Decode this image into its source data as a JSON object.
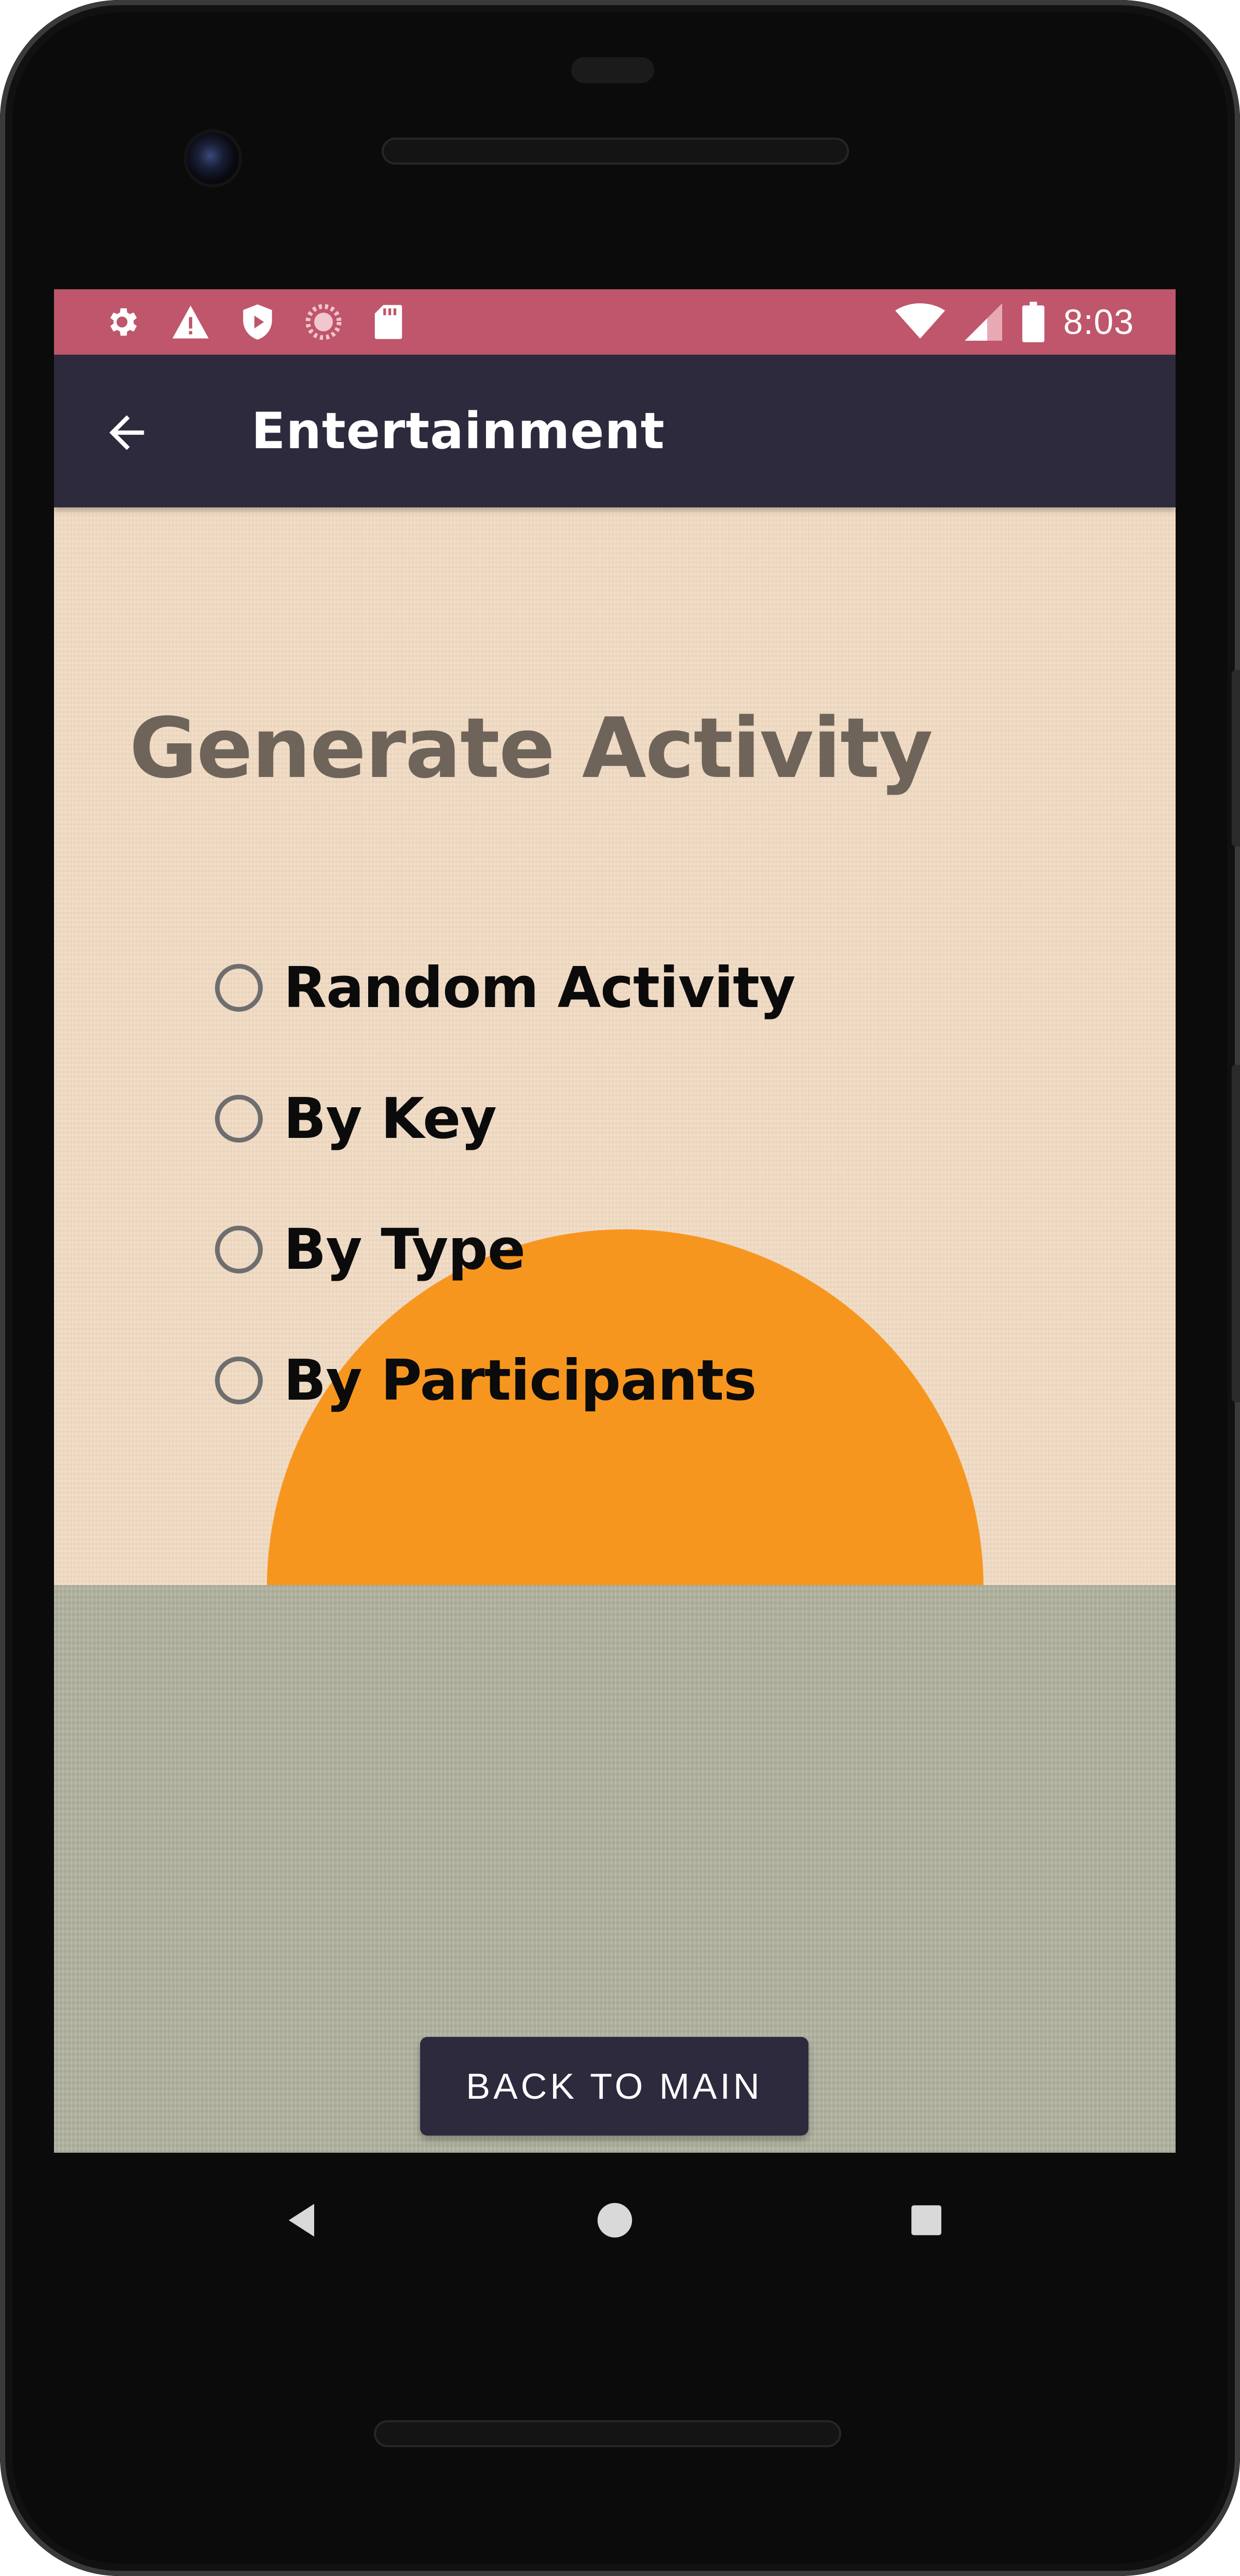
{
  "status_bar": {
    "time": "8:03",
    "background_color": "#bf566b",
    "left_icons": [
      "settings-icon",
      "warning-icon",
      "shield-icon",
      "loading-icon",
      "sd-card-icon"
    ],
    "right_icons": [
      "wifi-icon",
      "signal-icon",
      "battery-icon"
    ]
  },
  "app_bar": {
    "title": "Entertainment",
    "back_icon": "arrow-left-icon",
    "background_color": "#2e2a3d"
  },
  "main": {
    "heading": "Generate Activity",
    "options": [
      {
        "label": "Random Activity",
        "selected": false
      },
      {
        "label": "By Key",
        "selected": false
      },
      {
        "label": "By Type",
        "selected": false
      },
      {
        "label": "By Participants",
        "selected": false
      }
    ],
    "back_button_label": "BACK TO MAIN"
  },
  "nav_bar": {
    "buttons": [
      "back-triangle-icon",
      "home-circle-icon",
      "recents-square-icon"
    ]
  },
  "colors": {
    "sky": "#f2dbc4",
    "sun": "#f7961f",
    "ground": "#b2b3a0",
    "heading": "#6e6459"
  }
}
